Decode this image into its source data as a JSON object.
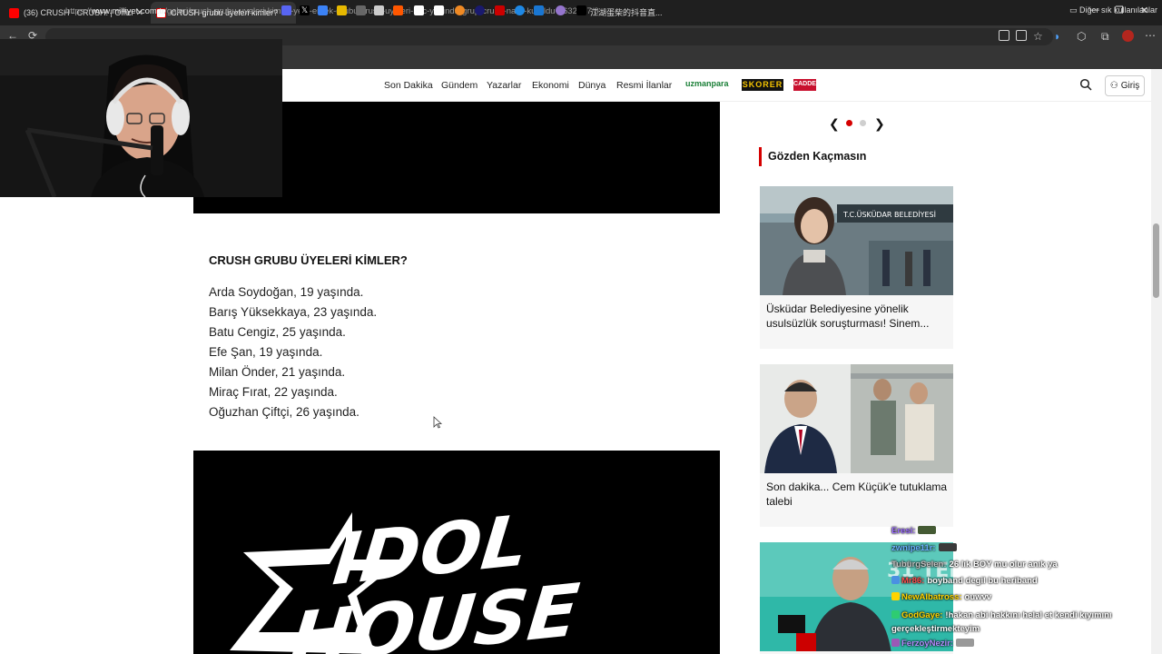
{
  "browser": {
    "tabs": [
      {
        "title": "(36) CRUSH - CRUSH! | Official Mu",
        "active": false,
        "favicon": "youtube-icon"
      },
      {
        "title": "CRUSH grubu üyeleri kimler? Yeni",
        "active": true,
        "favicon": "milliyet-icon"
      }
    ],
    "url_prefix": "https://",
    "url_host": "www.milliyet.com.tr",
    "url_path": "/galeri/crush-grubu-uyeleri-kimler-yeni-erkek-grubu-crush-uyeleri-kac-yasinda-grup-crush-nasil-kuruldu-7632857/3",
    "bookmark_text": "江湖蛋柴的抖音直...",
    "bookmark_folder": "Diğer sık kullanılanlar"
  },
  "site": {
    "nav": [
      "Son Dakika",
      "Gündem",
      "Yazarlar",
      "Ekonomi",
      "Dünya",
      "Resmi İlanlar"
    ],
    "brands": {
      "uzmanpara": "uzmanpara",
      "skorer": "SKORER",
      "cadde": "CADDE"
    },
    "login_label": "Giriş"
  },
  "article": {
    "heading": "CRUSH GRUBU ÜYELERİ KİMLER?",
    "members": [
      "Arda Soydoğan, 19 yaşında.",
      "Barış Yüksekkaya, 23 yaşında.",
      "Batu Cengiz, 25 yaşında.",
      "Efe Şan, 19 yaşında.",
      "Milan Önder, 21 yaşında.",
      "Miraç Fırat, 22 yaşında.",
      "Oğuzhan Çiftçi, 26 yaşında."
    ],
    "image_logo_line1": "IDOL",
    "image_logo_line2": "HOUSE"
  },
  "sidebar": {
    "title": "Gözden Kaçmasın",
    "carousel_active": 1,
    "carousel_total": 2,
    "cards": [
      {
        "caption": "Üsküdar Belediyesine yönelik usulsüzlük soruşturması! Sinem...",
        "sign": "T.C.ÜSKÜDAR BELEDİYESİ"
      },
      {
        "caption": "Son dakika... Cem Küçük'e tutuklama talebi"
      },
      {
        "caption": "",
        "banner": "31 TEM"
      }
    ]
  },
  "chat": [
    {
      "user": "Eresi:",
      "text": "",
      "color": "#9b6bff"
    },
    {
      "user": "zwnipe11r:",
      "text": "",
      "color": "#6ab0ff"
    },
    {
      "user": "TubürgSelen:",
      "text": "26 lık BOY mu olur anık ya",
      "color": "#c0c0c0"
    },
    {
      "user": "Mr86:",
      "text": "boyband degil bu heriband",
      "color": "#ff4d4d"
    },
    {
      "user": "NewAlbatross:",
      "text": "ouwvv",
      "color": "#ffd400"
    },
    {
      "user": "GodGaye:",
      "text": "!hakan abi hakkını helal et kendi kıyımını gerçekleştirmekteyim",
      "color": "#ffd400"
    },
    {
      "user": "FerzoyNezir:",
      "text": "",
      "color": "#b38cff"
    }
  ],
  "colors": {
    "accent": "#d50000",
    "chrome_dark": "#1f1f1f",
    "chrome_mid": "#353535"
  }
}
